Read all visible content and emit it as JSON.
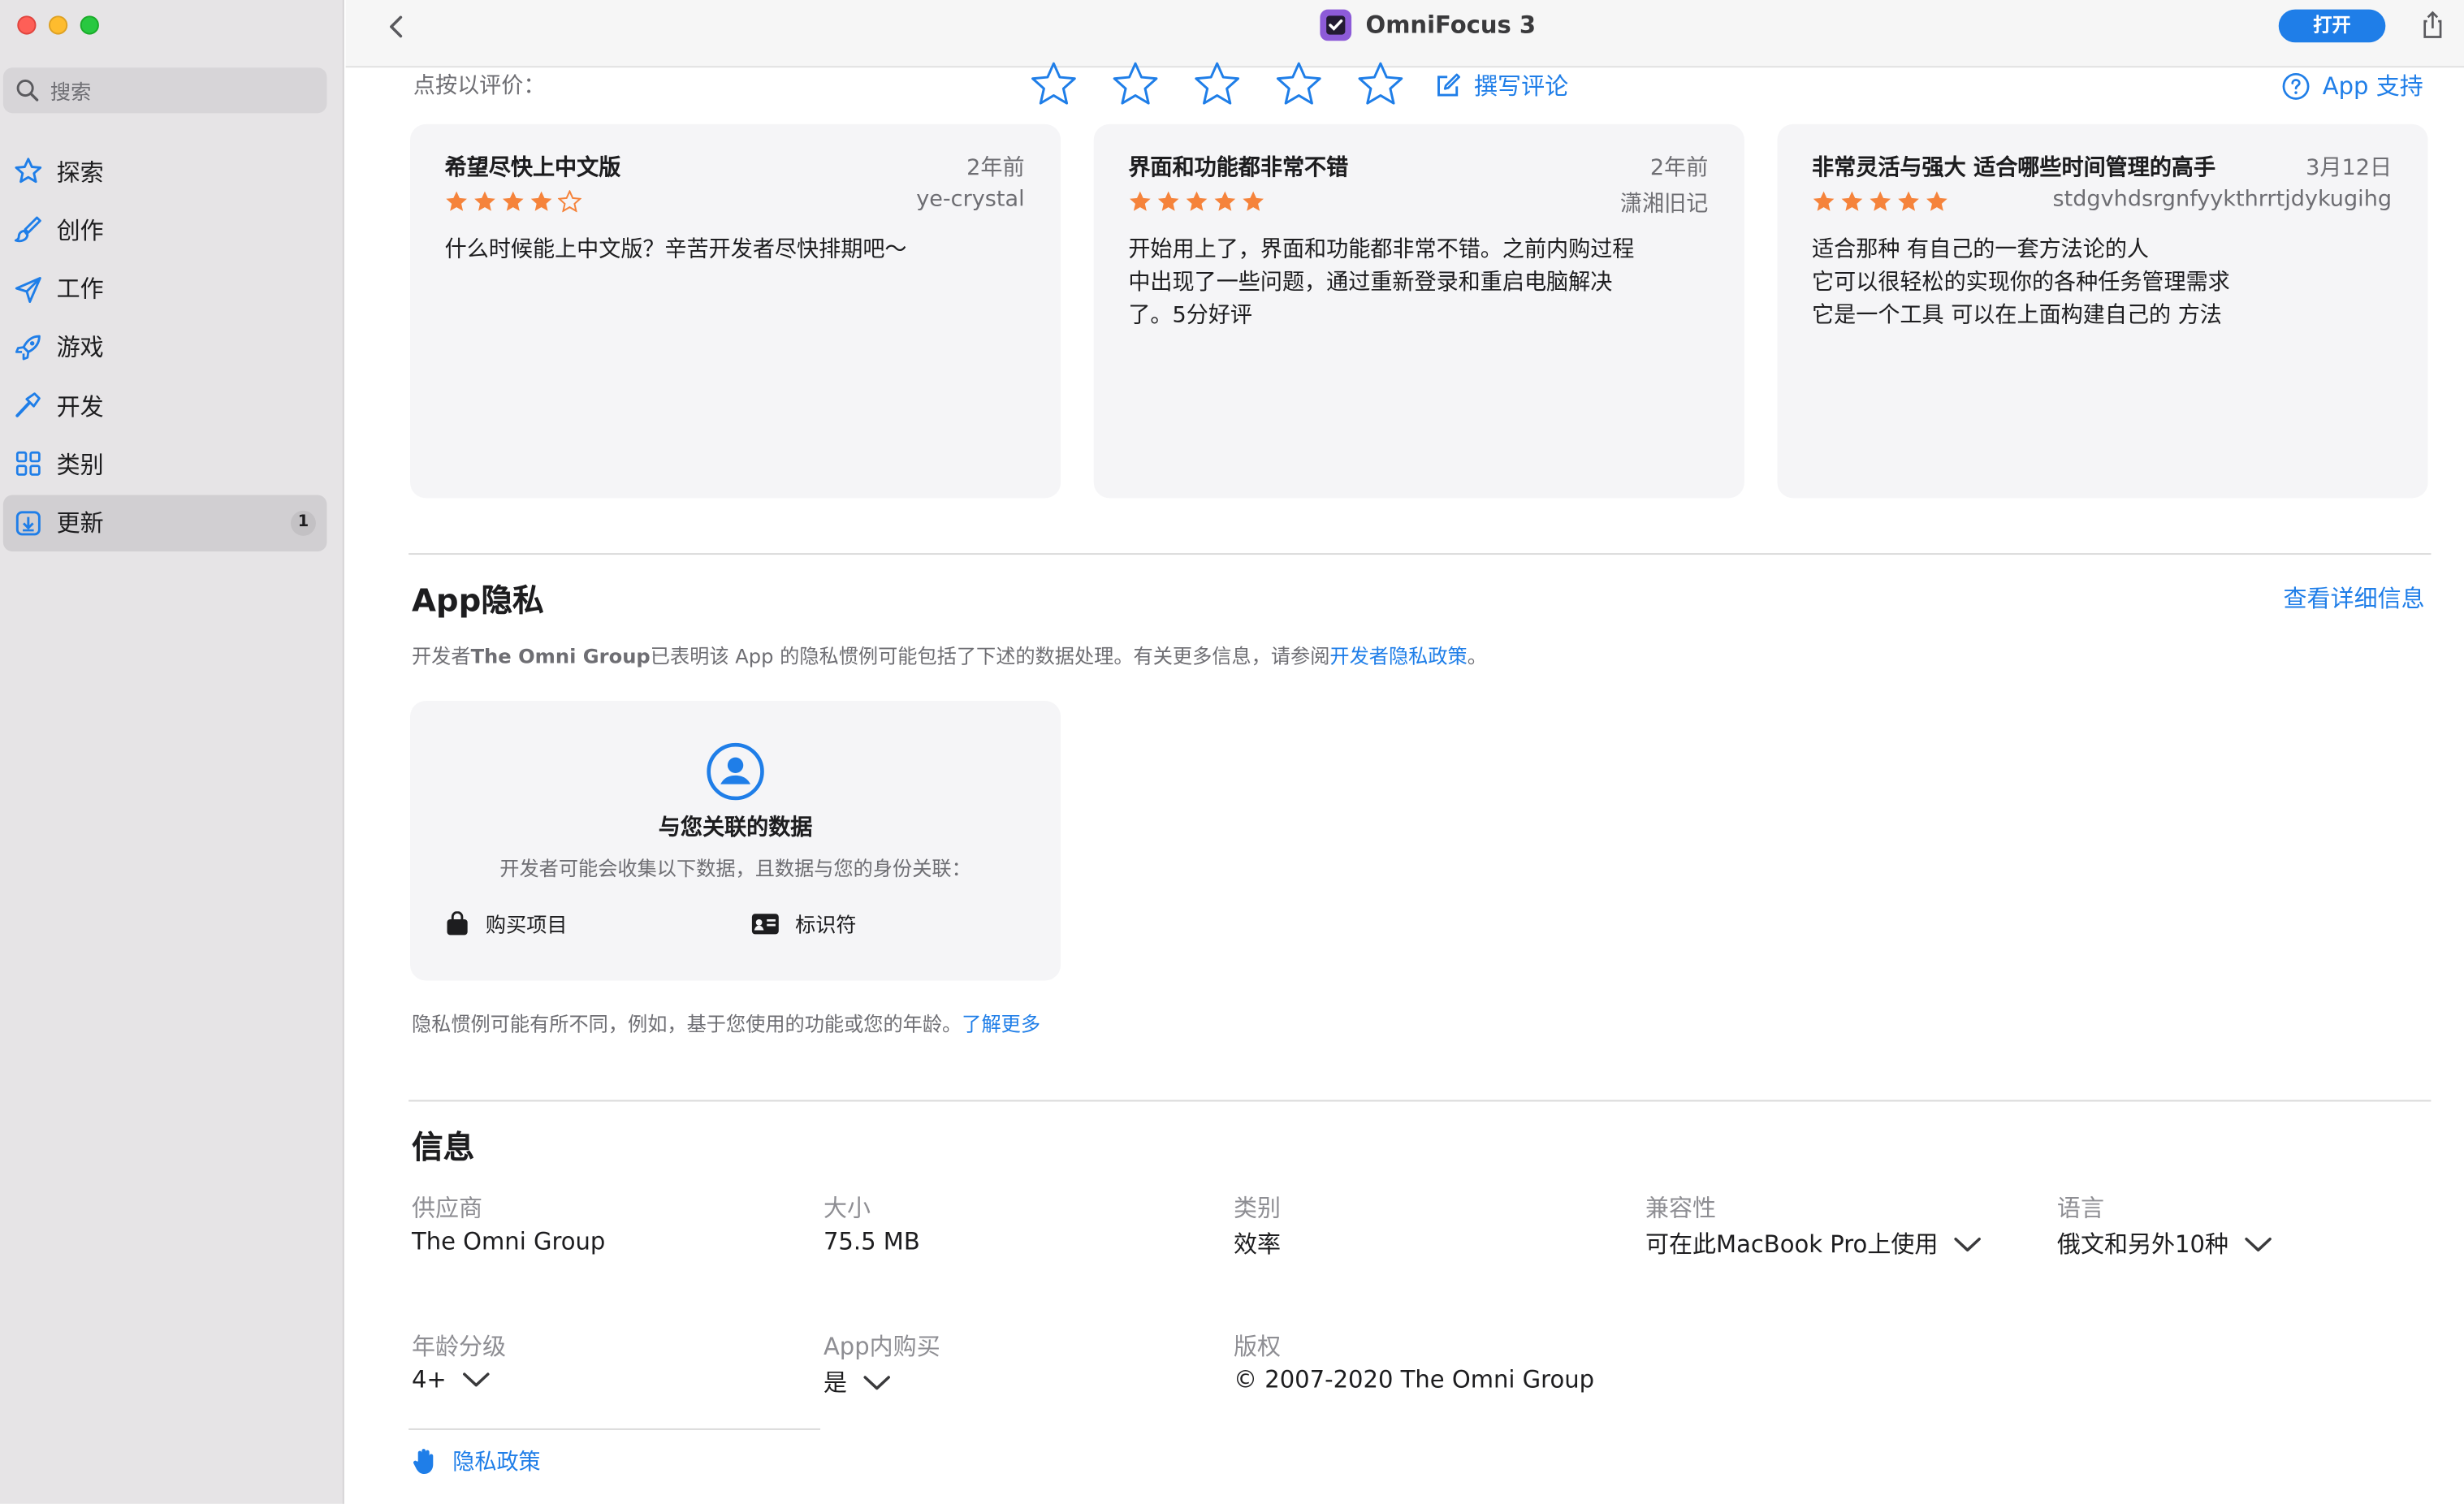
{
  "sidebar": {
    "search_placeholder": "搜索",
    "items": [
      {
        "label": "探索",
        "icon": "star-icon"
      },
      {
        "label": "创作",
        "icon": "brush-icon"
      },
      {
        "label": "工作",
        "icon": "paperplane-icon"
      },
      {
        "label": "游戏",
        "icon": "rocket-icon"
      },
      {
        "label": "开发",
        "icon": "hammer-icon"
      },
      {
        "label": "类别",
        "icon": "grid-icon"
      },
      {
        "label": "更新",
        "icon": "download-icon",
        "badge": "1",
        "active": true
      }
    ]
  },
  "toolbar": {
    "app_name": "OmniFocus 3",
    "open_label": "打开"
  },
  "rating": {
    "prompt": "点按以评价：",
    "write_review": "撰写评论",
    "app_support": "App 支持"
  },
  "reviews": [
    {
      "title": "希望尽快上中文版",
      "date": "2年前",
      "author": "ye-crystal",
      "stars": 4,
      "body": "什么时候能上中文版？辛苦开发者尽快排期吧～"
    },
    {
      "title": "界面和功能都非常不错",
      "date": "2年前",
      "author": "潇湘旧记",
      "stars": 5,
      "body": "开始用上了，界面和功能都非常不错。之前内购过程\n中出现了一些问题，通过重新登录和重启电脑解决\n了。5分好评"
    },
    {
      "title": "非常灵活与强大 适合哪些时间管理的高手",
      "date": "3月12日",
      "author": "stdgvhdsrgnfyykthrrtjdykugihg",
      "stars": 5,
      "body": "适合那种 有自己的一套方法论的人\n它可以很轻松的实现你的各种任务管理需求\n它是一个工具 可以在上面构建自己的 方法"
    }
  ],
  "privacy": {
    "title": "App隐私",
    "detail_link": "查看详细信息",
    "desc_prefix": "开发者",
    "developer": "The Omni Group",
    "desc_middle": "已表明该 App 的隐私惯例可能包括了下述的数据处理。有关更多信息，请参阅",
    "policy_link": "开发者隐私政策",
    "desc_suffix": "。",
    "card_title": "与您关联的数据",
    "card_sub": "开发者可能会收集以下数据，且数据与您的身份关联：",
    "item1": "购买项目",
    "item2": "标识符",
    "note": "隐私惯例可能有所不同，例如，基于您使用的功能或您的年龄。",
    "learn_more": "了解更多"
  },
  "info": {
    "title": "信息",
    "provider_k": "供应商",
    "provider_v": "The Omni Group",
    "size_k": "大小",
    "size_v": "75.5 MB",
    "category_k": "类别",
    "category_v": "效率",
    "compat_k": "兼容性",
    "compat_v": "可在此MacBook Pro上使用",
    "lang_k": "语言",
    "lang_v": "俄文和另外10种",
    "age_k": "年龄分级",
    "age_v": "4+",
    "iap_k": "App内购买",
    "iap_v": "是",
    "copyright_k": "版权",
    "copyright_v": "© 2007-2020 The Omni Group",
    "privacy_policy": "隐私政策"
  },
  "colors": {
    "accent": "#1f7ee8",
    "star_orange": "#f5833b"
  }
}
